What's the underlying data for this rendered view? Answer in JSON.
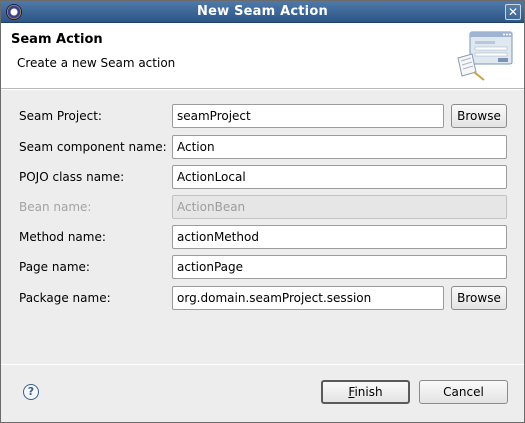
{
  "window": {
    "title": "New Seam Action",
    "close_glyph": "✕"
  },
  "banner": {
    "title": "Seam Action",
    "description": "Create a new Seam action",
    "icon": "wizard-banner-icon"
  },
  "form": {
    "seam_project": {
      "label": "Seam Project:",
      "value": "seamProject",
      "browse": "Browse"
    },
    "component_name": {
      "label": "Seam component name:",
      "value": "Action"
    },
    "pojo_class": {
      "label": "POJO class name:",
      "value": "ActionLocal"
    },
    "bean_name": {
      "label": "Bean name:",
      "value": "ActionBean",
      "disabled": true
    },
    "method_name": {
      "label": "Method name:",
      "value": "actionMethod"
    },
    "page_name": {
      "label": "Page name:",
      "value": "actionPage"
    },
    "package_name": {
      "label": "Package name:",
      "value": "org.domain.seamProject.session",
      "browse": "Browse"
    }
  },
  "footer": {
    "help_glyph": "?",
    "finish_mnemonic": "F",
    "finish_rest": "inish",
    "cancel": "Cancel"
  }
}
